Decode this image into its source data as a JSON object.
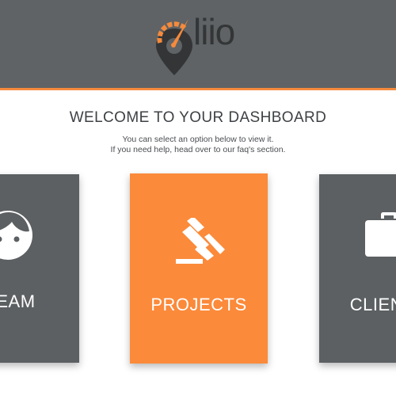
{
  "header": {
    "logo_text": "liio"
  },
  "welcome": {
    "title": "WELCOME TO YOUR DASHBOARD",
    "line1": "You can select an option below to view it.",
    "line2": "If you need help, head over to our faq's section."
  },
  "cards": [
    {
      "label": "TEAM",
      "icon": "face-icon"
    },
    {
      "label": "PROJECTS",
      "icon": "gavel-icon"
    },
    {
      "label": "CLIENTS",
      "icon": "briefcase-icon"
    }
  ],
  "colors": {
    "header_bg": "#5f6365",
    "accent": "#f58a3c",
    "card_gray": "#5c6062",
    "card_orange": "#fb8a3a",
    "logo_text": "#333536"
  }
}
